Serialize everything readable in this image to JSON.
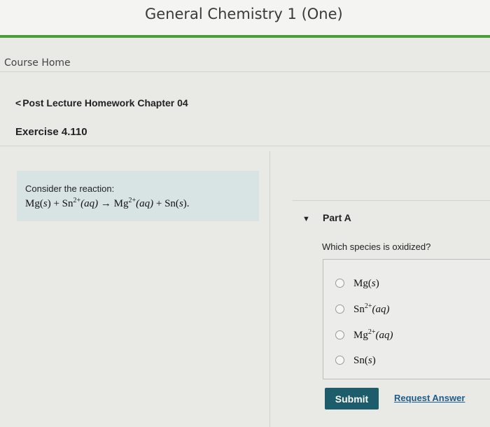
{
  "header": {
    "course_title": "General Chemistry 1 (One)"
  },
  "nav": {
    "course_home": "Course Home"
  },
  "breadcrumb": {
    "chevron": "<",
    "label": "Post Lecture Homework Chapter 04"
  },
  "exercise": {
    "title": "Exercise 4.110"
  },
  "problem": {
    "intro": "Consider the reaction:",
    "reaction": {
      "t1": "Mg(",
      "t1i": "s",
      "t1e": ")",
      "plus1": " + ",
      "t2": "Sn",
      "t2sup": "2+",
      "t2i": "(aq)",
      "arrow": " → ",
      "t3": "Mg",
      "t3sup": "2+",
      "t3i": "(aq)",
      "plus2": " + ",
      "t4": "Sn(",
      "t4i": "s",
      "t4e": ")."
    }
  },
  "part": {
    "caret": "▼",
    "title": "Part A",
    "question": "Which species is oxidized?",
    "options": [
      {
        "base": "Mg(",
        "sup": "",
        "italic": "s",
        "end": ")"
      },
      {
        "base": "Sn",
        "sup": "2+",
        "italic": "(aq)",
        "end": ""
      },
      {
        "base": "Mg",
        "sup": "2+",
        "italic": "(aq)",
        "end": ""
      },
      {
        "base": "Sn(",
        "sup": "",
        "italic": "s",
        "end": ")"
      }
    ],
    "submit_label": "Submit",
    "request_label": "Request Answer"
  },
  "colors": {
    "accent_green": "#4a9e3c",
    "submit_bg": "#1d5c6a",
    "problem_bg": "#d7e4e3",
    "link": "#1d5c8a"
  }
}
